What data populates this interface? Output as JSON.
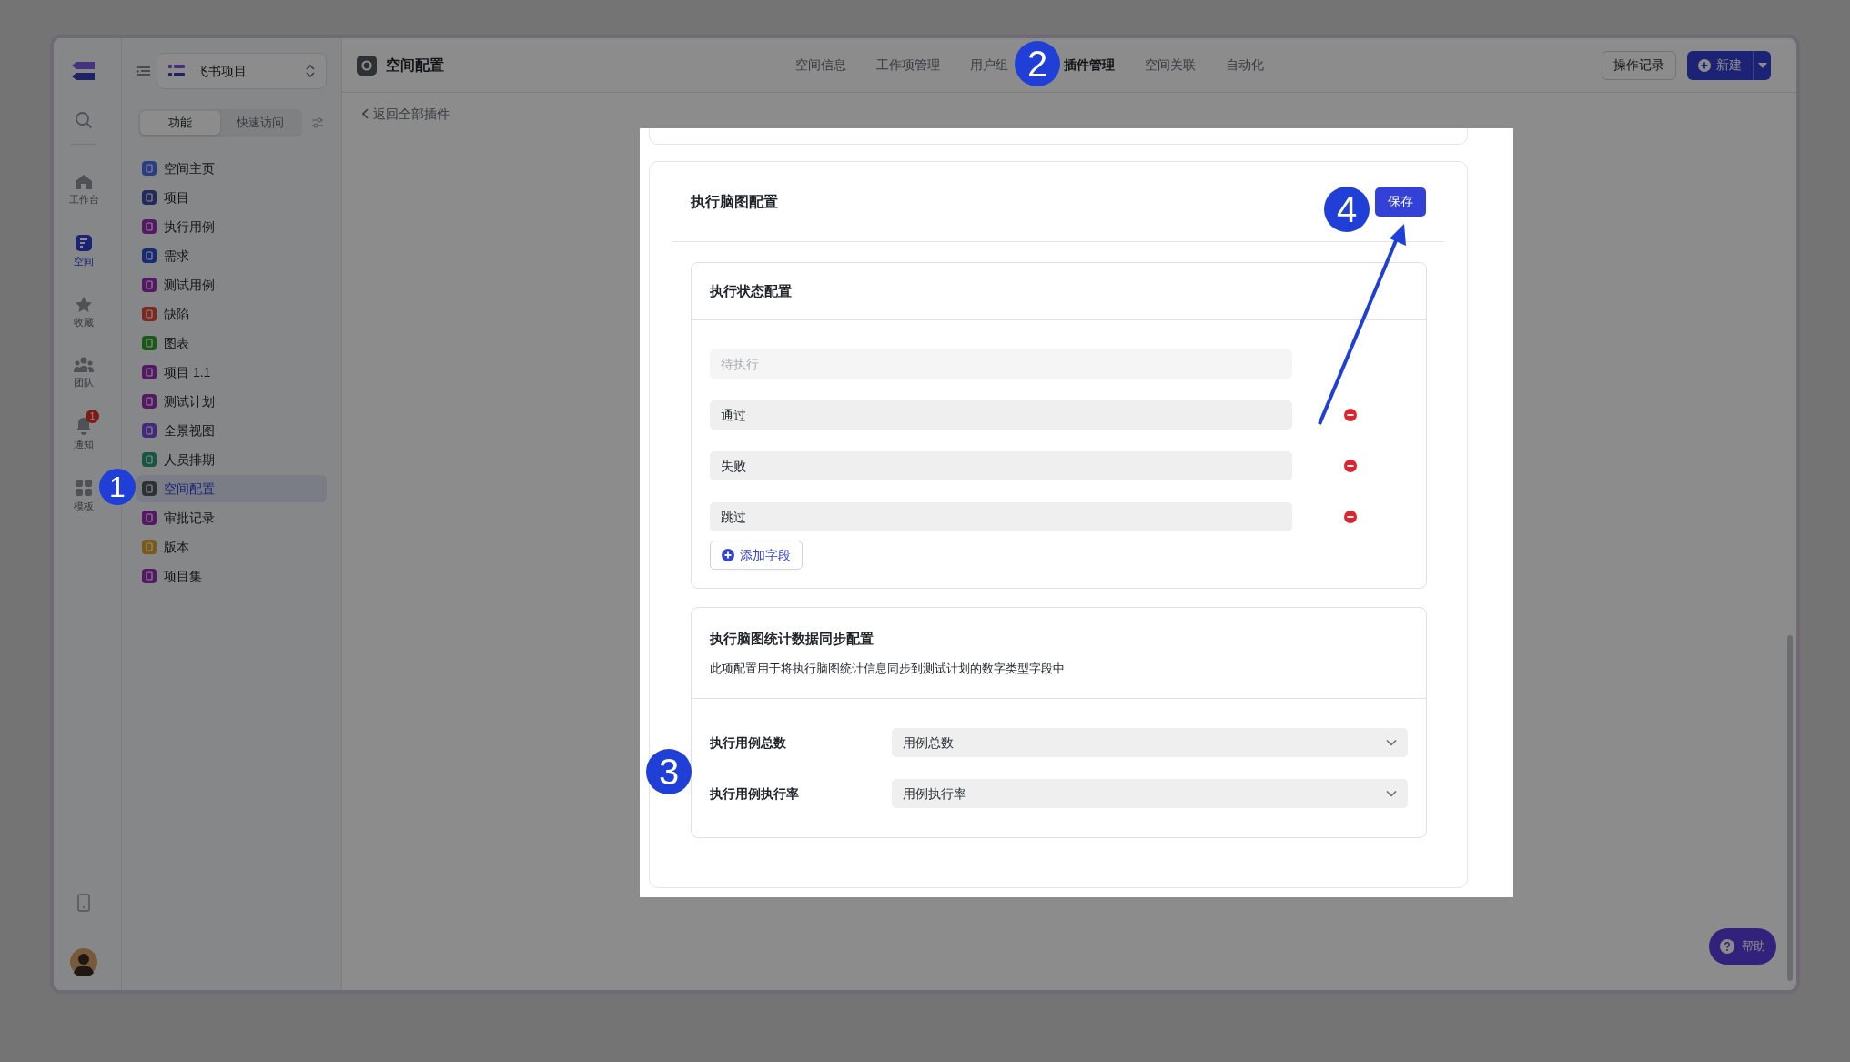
{
  "rail": {
    "items": [
      {
        "label": "工作台",
        "kind": "home",
        "selected": false
      },
      {
        "label": "空间",
        "kind": "space",
        "selected": true
      },
      {
        "label": "收藏",
        "kind": "favorites",
        "selected": false
      },
      {
        "label": "团队",
        "kind": "team",
        "selected": false
      },
      {
        "label": "通知",
        "kind": "notifications",
        "selected": false,
        "badge": "1"
      },
      {
        "label": "模板",
        "kind": "templates",
        "selected": false
      }
    ]
  },
  "sidebar": {
    "workspace": "飞书项目",
    "tabs": [
      {
        "label": "功能",
        "selected": true
      },
      {
        "label": "快速访问",
        "selected": false
      }
    ],
    "items": [
      {
        "label": "空间主页",
        "color": "#2b3d85",
        "selected": false
      },
      {
        "label": "项目",
        "color": "#23295c",
        "selected": false
      },
      {
        "label": "执行用例",
        "color": "#551864",
        "selected": false
      },
      {
        "label": "需求",
        "color": "#172b76",
        "selected": false
      },
      {
        "label": "测试用例",
        "color": "#551864",
        "selected": false
      },
      {
        "label": "缺陷",
        "color": "#7e2820",
        "selected": false
      },
      {
        "label": "图表",
        "color": "#1a5b1a",
        "selected": false
      },
      {
        "label": "项目 1.1",
        "color": "#551864",
        "selected": false
      },
      {
        "label": "测试计划",
        "color": "#551864",
        "selected": false
      },
      {
        "label": "全景视图",
        "color": "#43297b",
        "selected": false
      },
      {
        "label": "人员排期",
        "color": "#185643",
        "selected": false
      },
      {
        "label": "空间配置",
        "color": "#2f3134",
        "selected": true
      },
      {
        "label": "审批记录",
        "color": "#551864",
        "selected": false
      },
      {
        "label": "版本",
        "color": "#7b5b17",
        "selected": false
      },
      {
        "label": "项目集",
        "color": "#551864",
        "selected": false
      }
    ]
  },
  "topbar": {
    "title": "空间配置",
    "tabs": [
      {
        "label": "空间信息",
        "selected": false
      },
      {
        "label": "工作项管理",
        "selected": false
      },
      {
        "label": "用户组",
        "selected": false
      },
      {
        "label": "插件管理",
        "selected": true
      },
      {
        "label": "空间关联",
        "selected": false
      },
      {
        "label": "自动化",
        "selected": false
      }
    ],
    "history_button": "操作记录",
    "new_button": "新建"
  },
  "back_link": "返回全部插件",
  "modal": {
    "title": "执行脑图配置",
    "save_button": "保存",
    "status_section": {
      "title": "执行状态配置",
      "fields": [
        {
          "value": "待执行",
          "disabled": true,
          "removable": false
        },
        {
          "value": "通过",
          "disabled": false,
          "removable": true
        },
        {
          "value": "失败",
          "disabled": false,
          "removable": true
        },
        {
          "value": "跳过",
          "disabled": false,
          "removable": true
        }
      ],
      "add_button": "添加字段"
    },
    "sync_section": {
      "title": "执行脑图统计数据同步配置",
      "description": "此项配置用于将执行脑图统计信息同步到测试计划的数字类型字段中",
      "rows": [
        {
          "label": "执行用例总数",
          "value": "用例总数"
        },
        {
          "label": "执行用例执行率",
          "value": "用例执行率"
        }
      ]
    }
  },
  "help_button": "帮助",
  "callouts": [
    "1",
    "2",
    "3",
    "4"
  ]
}
